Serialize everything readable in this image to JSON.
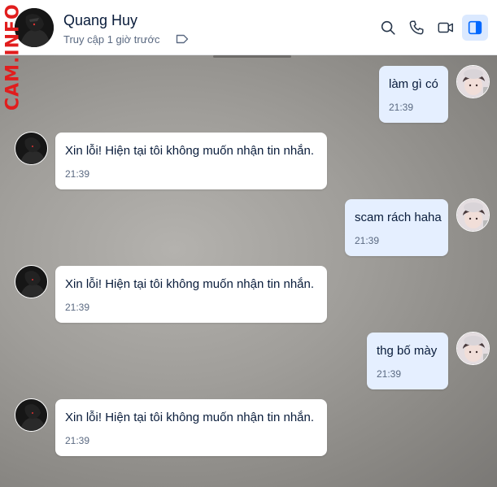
{
  "header": {
    "name": "Quang Huy",
    "status": "Truy cập 1 giờ trước",
    "icons": [
      "search-icon",
      "phone-icon",
      "video-icon",
      "sidebar-toggle-icon"
    ]
  },
  "watermark": "CAM.INFO",
  "messages": [
    {
      "direction": "out",
      "text": "làm gì có",
      "time": "21:39"
    },
    {
      "direction": "in",
      "text": "Xin lỗi! Hiện tại tôi không muốn nhận tin nhắn.",
      "time": "21:39"
    },
    {
      "direction": "out",
      "text": "scam rách haha",
      "time": "21:39"
    },
    {
      "direction": "in",
      "text": "Xin lỗi! Hiện tại tôi không muốn nhận tin nhắn.",
      "time": "21:39"
    },
    {
      "direction": "out",
      "text": "thg bố mày",
      "time": "21:39"
    },
    {
      "direction": "in",
      "text": "Xin lỗi! Hiện tại tôi không muốn nhận tin nhắn.",
      "time": "21:39"
    }
  ],
  "colors": {
    "accent": "#0068ff",
    "outgoing_bubble": "#e5efff",
    "incoming_bubble": "#ffffff",
    "watermark": "#e11d1d"
  }
}
